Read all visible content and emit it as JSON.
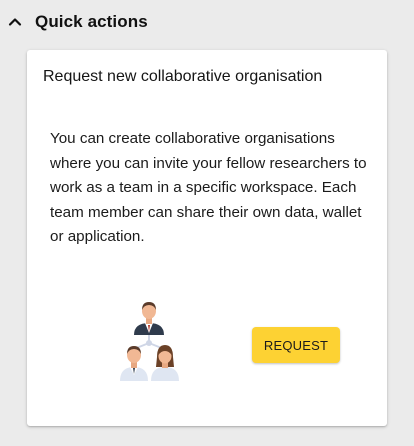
{
  "section": {
    "title": "Quick actions",
    "icon": "chevron-up-icon"
  },
  "card": {
    "title": "Request new collaborative organisation",
    "description": "You can create collaborative organisations where you can invite your fellow researchers to work as a team in a specific workspace. Each team member can share their own data, wallet or application.",
    "illustration_icon": "team-hierarchy-icon",
    "button_label": "REQUEST"
  },
  "colors": {
    "background": "#ebebeb",
    "card": "#ffffff",
    "button": "#fdd233"
  }
}
